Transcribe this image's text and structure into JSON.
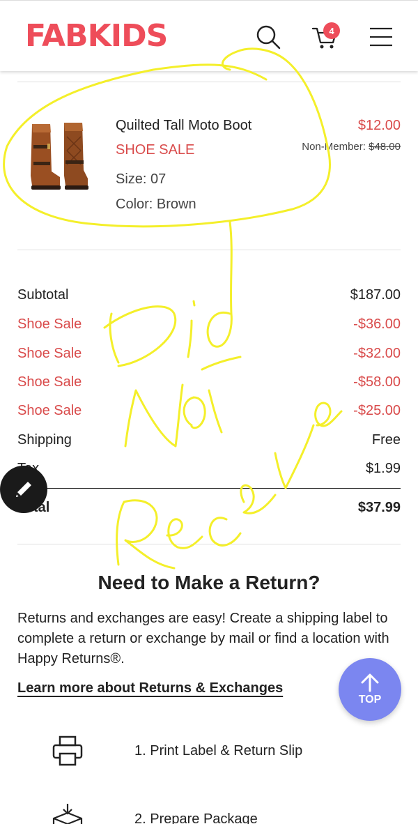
{
  "header": {
    "logo": "FABKIDS",
    "cart_count": "4",
    "icons": [
      "search-icon",
      "cart-icon",
      "menu-icon"
    ]
  },
  "item": {
    "name": "Quilted Tall Moto Boot",
    "sale_label": "SHOE SALE",
    "size": "Size: 07",
    "color": "Color: Brown",
    "price": "$12.00",
    "member_label": "Non-Member:",
    "member_price": "$48.00"
  },
  "summary": {
    "subtotal_label": "Subtotal",
    "subtotal_value": "$187.00",
    "discounts": [
      {
        "label": "Shoe Sale",
        "value": "-$36.00"
      },
      {
        "label": "Shoe Sale",
        "value": "-$32.00"
      },
      {
        "label": "Shoe Sale",
        "value": "-$58.00"
      },
      {
        "label": "Shoe Sale",
        "value": "-$25.00"
      }
    ],
    "shipping_label": "Shipping",
    "shipping_value": "Free",
    "tax_label": "Tax",
    "tax_value": "$1.99",
    "total_label": "Total",
    "total_value": "$37.99"
  },
  "returns": {
    "title": "Need to Make a Return?",
    "text": "Returns and exchanges are easy! Create a shipping label to complete a return or exchange by mail or find a location with Happy Returns®.",
    "link": "Learn more about Returns & Exchanges",
    "steps": [
      {
        "label": "1. Print Label & Return Slip",
        "icon": "printer-icon"
      },
      {
        "label": "2. Prepare Package",
        "icon": "package-icon"
      }
    ]
  },
  "fab": {
    "top_label": "TOP",
    "edit_icon": "pencil-icon"
  },
  "colors": {
    "brand": "#ee4d5a",
    "sale": "#d94b4b",
    "top_button": "#7b86f0",
    "annotation": "#f4ef2a"
  }
}
